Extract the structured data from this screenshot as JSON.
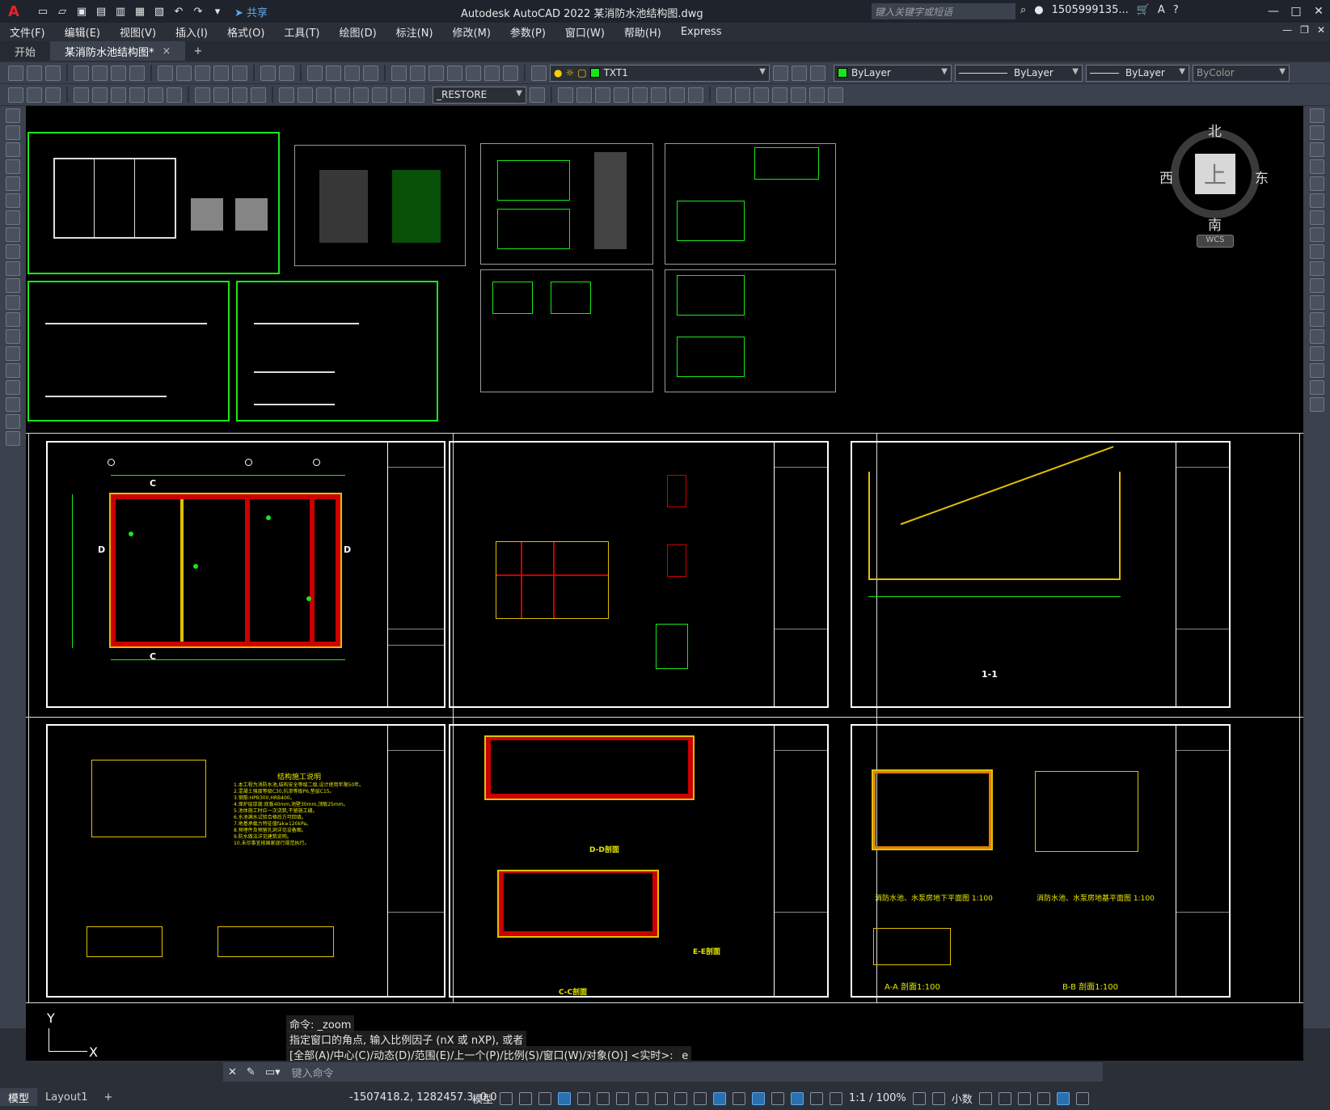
{
  "app": {
    "title": "Autodesk AutoCAD 2022    某消防水池结构图.dwg",
    "logo_letter": "A",
    "share_label": "共享",
    "search_placeholder": "键入关键字或短语",
    "user": "1505999135...",
    "accent": "#19e619"
  },
  "menu": {
    "items": [
      "文件(F)",
      "编辑(E)",
      "视图(V)",
      "插入(I)",
      "格式(O)",
      "工具(T)",
      "绘图(D)",
      "标注(N)",
      "修改(M)",
      "参数(P)",
      "窗口(W)",
      "帮助(H)",
      "Express"
    ]
  },
  "tabs": {
    "start": "开始",
    "doc": "某消防水池结构图*",
    "close": "×",
    "add": "+"
  },
  "toolbar": {
    "layer": "TXT1",
    "color": "ByLayer",
    "linetype": "ByLayer",
    "lineweight": "ByLayer",
    "plotstyle": "ByColor",
    "view": "_RESTORE"
  },
  "viewcube": {
    "north": "北",
    "south": "南",
    "east": "东",
    "west": "西",
    "face": "上",
    "wcs": "WCS"
  },
  "drawing": {
    "sections": {
      "s1": "C",
      "s2": "C",
      "s3": "D",
      "s4": "D",
      "aa": "A-A 剖面1:100",
      "bb": "B-B 剖面1:100",
      "plan_lower": "消防水池、水泵房地下平面图 1:100",
      "plan_base": "消防水池、水泵房地基平面图 1:100",
      "dd": "D-D剖面",
      "cc": "C-C剖面",
      "ee": "E-E剖面",
      "l1": "1-1"
    },
    "notes_title": "结构施工说明",
    "notes": "1.本工程为消防水池,结构安全等级二级,设计使用年限50年。\n2.混凝土强度等级C30,抗渗等级P6,垫层C15。\n3.钢筋:HPB300,HRB400。\n4.保护层厚度:底板40mm,池壁30mm,顶板25mm。\n5.池体施工时应一次浇筑,不留施工缝。\n6.水池满水试验合格后方可回填。\n7.地基承载力特征值fak≥120kPa。\n8.预埋件及预留孔洞详见设备图。\n9.防水做法详见建筑说明。\n10.未尽事宜按国家现行规范执行。"
  },
  "command": {
    "hist1": "命令: _zoom",
    "hist2": "指定窗口的角点, 输入比例因子 (nX 或 nXP), 或者",
    "hist3": "[全部(A)/中心(C)/动态(D)/范围(E)/上一个(P)/比例(S)/窗口(W)/对象(O)] <实时>: _e",
    "placeholder": "键入命令"
  },
  "status": {
    "model_tab": "模型",
    "layout_tab": "Layout1",
    "coords": "-1507418.2, 1282457.3, 0.0",
    "space": "模型",
    "scale": "1:1 / 100%",
    "units": "小数"
  },
  "ucs": {
    "y": "Y",
    "x": "X"
  }
}
